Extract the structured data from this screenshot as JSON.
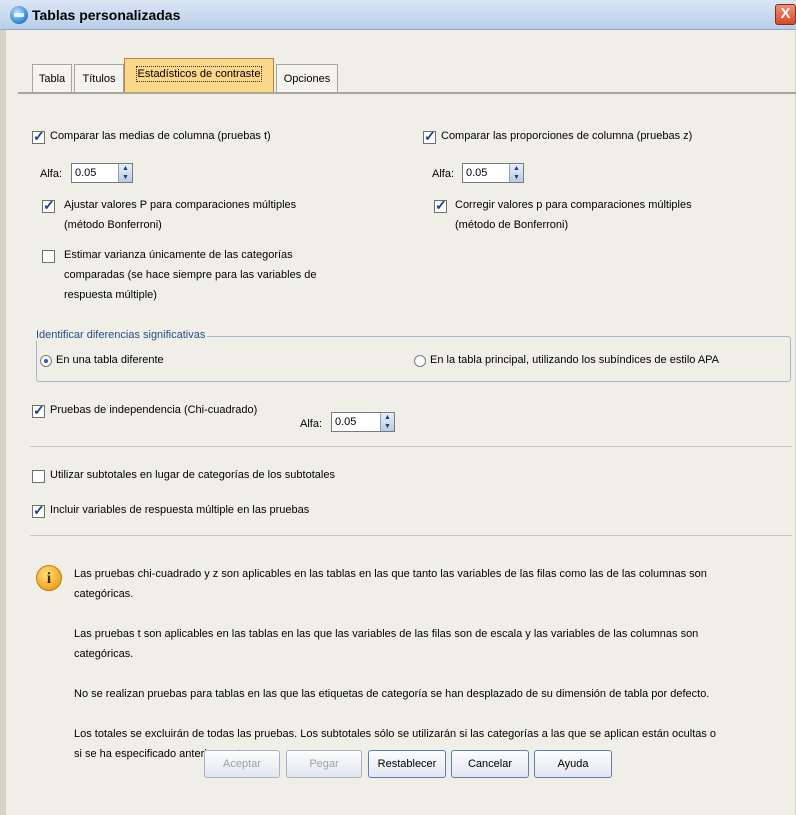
{
  "window": {
    "title": "Tablas personalizadas",
    "close_glyph": "X",
    "icon": "app-icon"
  },
  "tabs": [
    {
      "label": "Tabla",
      "active": false
    },
    {
      "label": "Títulos",
      "active": false
    },
    {
      "label": "Estadísticos de contraste",
      "active": true
    },
    {
      "label": "Opciones",
      "active": false
    }
  ],
  "left": {
    "compare_means": {
      "label": "Comparar las medias de columna (pruebas t)",
      "checked": true
    },
    "alpha_label": "Alfa:",
    "alpha_value": "0.05",
    "adjust_p": {
      "line1": "Ajustar valores P para comparaciones múltiples",
      "line2": "(método Bonferroni)",
      "checked": true
    },
    "estimate_var": {
      "line1": "Estimar varianza únicamente de las categorías",
      "line2": "comparadas (se hace siempre para las variables de",
      "line3": "respuesta múltiple)",
      "checked": false
    }
  },
  "right": {
    "compare_props": {
      "label": "Comparar las proporciones de columna (pruebas z)",
      "checked": true
    },
    "alpha_label": "Alfa:",
    "alpha_value": "0.05",
    "correct_p": {
      "line1": "Corregir valores p para comparaciones múltiples",
      "line2": "(método de Bonferroni)",
      "checked": true
    }
  },
  "identify": {
    "title": "Identificar diferencias significativas",
    "option_separate": "En una tabla diferente",
    "option_main": "En la tabla principal, utilizando los subíndices de estilo APA",
    "selected": "separate"
  },
  "chisq": {
    "label": "Pruebas de independencia (Chi-cuadrado)",
    "checked": true,
    "alpha_label": "Alfa:",
    "alpha_value": "0.05"
  },
  "subtotals": {
    "label": "Utilizar subtotales en lugar de categorías de los subtotales",
    "checked": false
  },
  "multiresp": {
    "label": "Incluir variables de respuesta múltiple en las pruebas",
    "checked": true
  },
  "info": {
    "icon": "info-icon",
    "p1a": "Las pruebas chi-cuadrado y z son aplicables en las tablas en las que tanto las variables de las filas como las de las columnas son",
    "p1b": "categóricas.",
    "p2a": "Las pruebas t son aplicables en las tablas en las que las variables de las filas son de escala y las variables de las columnas son",
    "p2b": "categóricas.",
    "p3": "No se realizan pruebas para tablas en las que las etiquetas de categoría se han desplazado de su dimensión de tabla por defecto.",
    "p4a": "Los totales se excluirán de todas las pruebas. Los subtotales sólo se utilizarán si las categorías a las que se aplican están ocultas o",
    "p4b": "si se ha especificado anteriormente."
  },
  "buttons": {
    "accept": "Aceptar",
    "paste": "Pegar",
    "reset": "Restablecer",
    "cancel": "Cancelar",
    "help": "Ayuda"
  }
}
